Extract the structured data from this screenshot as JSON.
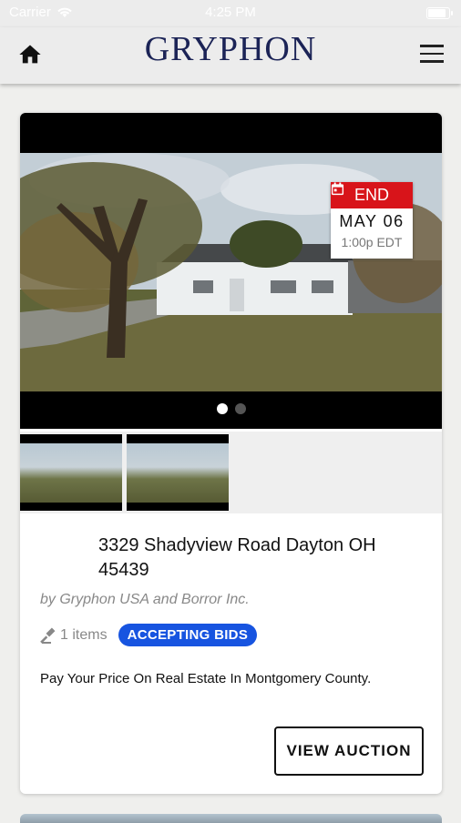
{
  "status_bar": {
    "carrier": "Carrier",
    "time": "4:25 PM"
  },
  "header": {
    "logo": "GRYPHON",
    "icons": [
      "home-icon",
      "hamburger-menu-icon"
    ]
  },
  "auction_card": {
    "end_badge": {
      "label": "END",
      "date": "MAY 06",
      "time": "1:00p EDT",
      "color": "#d8141a"
    },
    "carousel": {
      "count": 2,
      "active_index": 0
    },
    "thumbnails": 2,
    "title": "3329 Shadyview Road Dayton OH 45439",
    "seller": "by Gryphon USA and Borror Inc.",
    "items_count": "1 items",
    "status": "ACCEPTING BIDS",
    "status_color": "#1754e0",
    "description": "Pay Your Price On Real Estate In Montgomery County.",
    "view_button": "VIEW AUCTION"
  },
  "colors": {
    "brand": "#1b2356",
    "background": "#efefed"
  }
}
